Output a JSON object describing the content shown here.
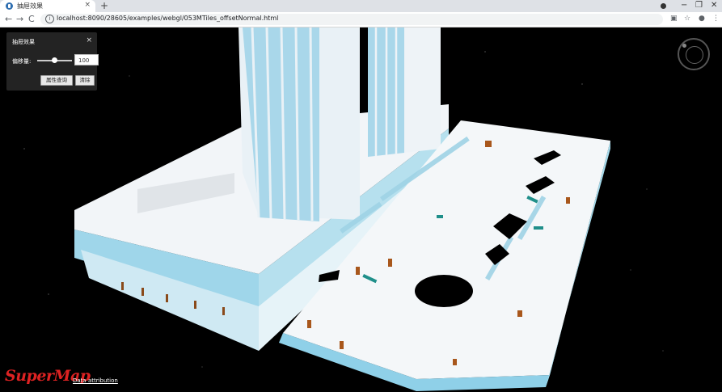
{
  "browser": {
    "tab_title": "抽屉效果",
    "tab_close": "×",
    "new_tab": "+",
    "url": "localhost:8090/28605/examples/webgl/053MTiles_offsetNormal.html",
    "controls": {
      "minimize": "−",
      "maximize": "❐",
      "close": "✕"
    }
  },
  "panel": {
    "title": "抽屉效果",
    "close": "×",
    "offset_label": "偏移量:",
    "offset_value": "100",
    "offset_slider_fraction": 0.5,
    "query_button": "属性查询",
    "clear_button": "清除"
  },
  "footer": {
    "logo": "SuperMap",
    "attribution": "Data attribution"
  },
  "colors": {
    "building": "#f2f5f8",
    "glass": "#8fd0e8",
    "accent": "#d22222"
  }
}
